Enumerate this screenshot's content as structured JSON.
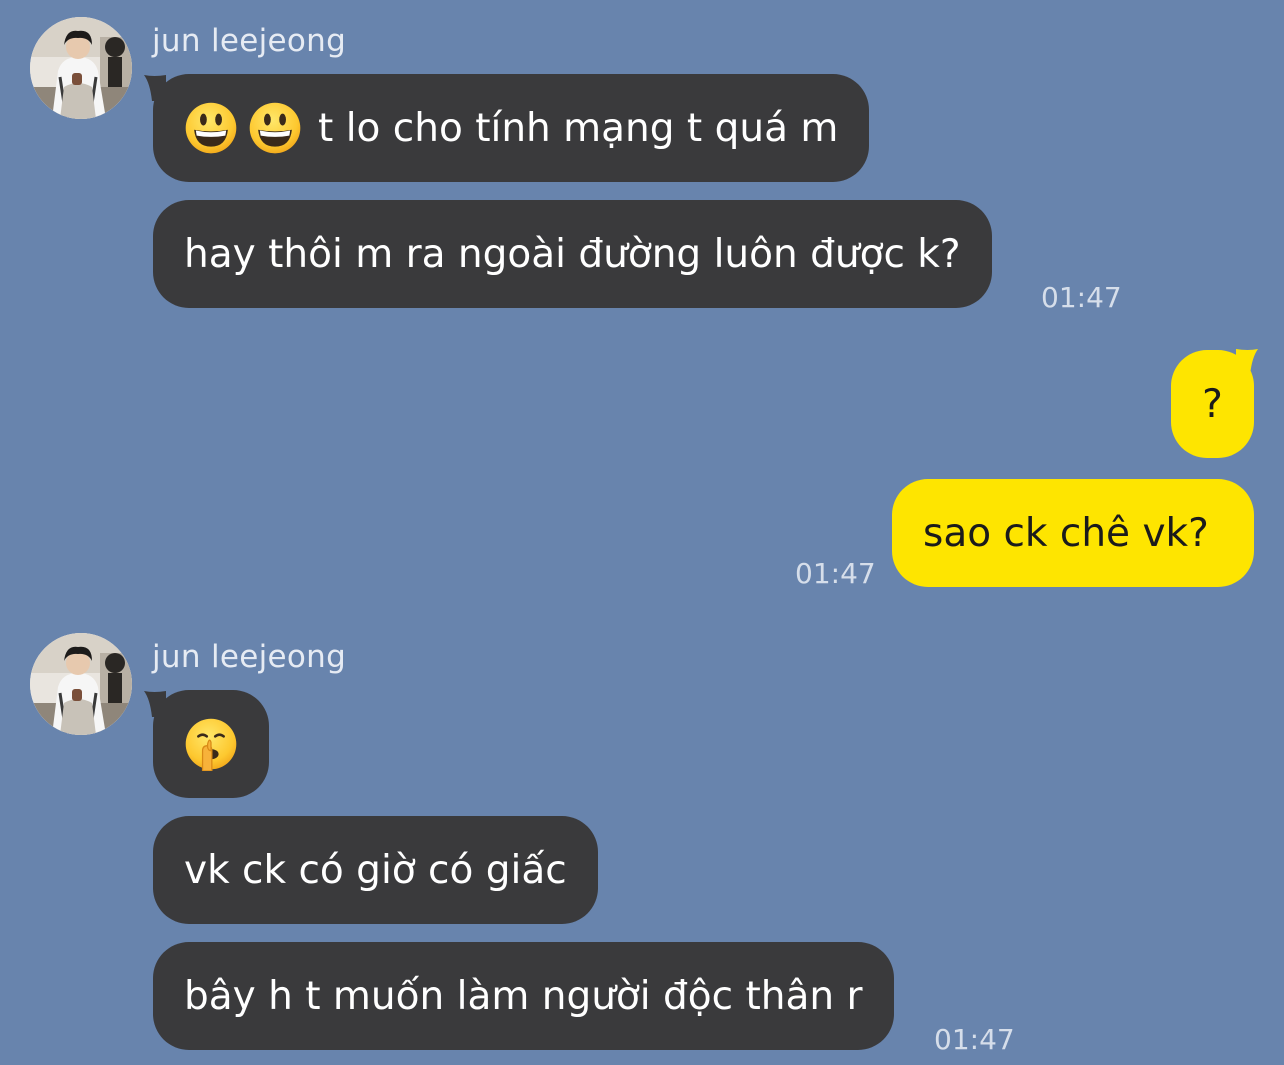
{
  "colors": {
    "background": "#6884ad",
    "incoming_bubble": "#3a3a3c",
    "outgoing_bubble": "#fee500"
  },
  "groups": [
    {
      "sender": "jun leejeong",
      "avatar": "profile-photo",
      "messages": [
        {
          "emojis": [
            "grinning-face",
            "grinning-face"
          ],
          "text": "t lo cho tính mạng t quá m"
        },
        {
          "text": "hay thôi m ra ngoài đường luôn được k?"
        }
      ],
      "time": "01:47"
    },
    {
      "sender": "me",
      "messages": [
        {
          "text": "?"
        },
        {
          "text": "sao ck chê vk?"
        }
      ],
      "time": "01:47"
    },
    {
      "sender": "jun leejeong",
      "avatar": "profile-photo",
      "messages": [
        {
          "emojis": [
            "shushing-face"
          ]
        },
        {
          "text": "vk ck có giờ có giấc"
        },
        {
          "text": "bây h t muốn làm người độc thân r"
        }
      ],
      "time": "01:47"
    }
  ]
}
